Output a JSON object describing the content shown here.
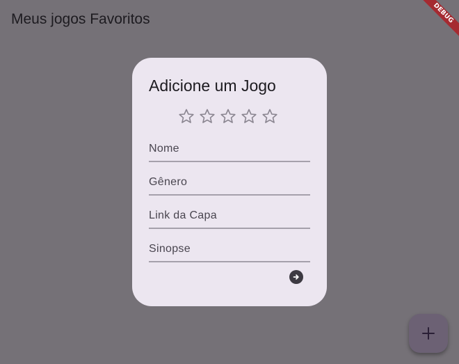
{
  "app_bar": {
    "title": "Meus jogos Favoritos",
    "debug_label": "DEBUG"
  },
  "dialog": {
    "title": "Adicione um Jogo",
    "rating": {
      "value": 0,
      "max": 5,
      "icon": "star-outline-icon"
    },
    "fields": {
      "nome_placeholder": "Nome",
      "genero_placeholder": "Gênero",
      "capa_placeholder": "Link da Capa",
      "sinopse_placeholder": "Sinopse"
    },
    "submit_icon": "arrow-right-circle-icon"
  },
  "fab": {
    "icon": "plus-icon"
  },
  "colors": {
    "scrim_background": "#757177",
    "dialog_background": "#ece6f0",
    "debug_ribbon": "#a52a31",
    "fab_background": "#6c6174"
  }
}
